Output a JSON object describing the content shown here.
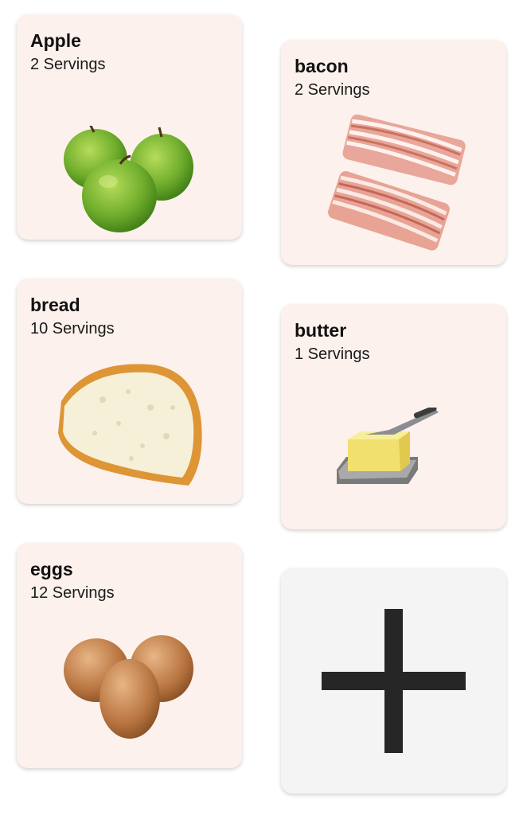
{
  "items": [
    {
      "name": "Apple",
      "servings": "2 Servings",
      "icon": "apple-icon"
    },
    {
      "name": "bacon",
      "servings": "2 Servings",
      "icon": "bacon-icon"
    },
    {
      "name": "bread",
      "servings": "10 Servings",
      "icon": "bread-icon"
    },
    {
      "name": "butter",
      "servings": "1 Servings",
      "icon": "butter-icon"
    },
    {
      "name": "eggs",
      "servings": "12 Servings",
      "icon": "eggs-icon"
    }
  ],
  "add_card": {
    "icon": "plus-icon"
  },
  "colors": {
    "card_bg": "#fcf1ec",
    "add_card_bg": "#f4f4f4",
    "plus": "#262626"
  }
}
